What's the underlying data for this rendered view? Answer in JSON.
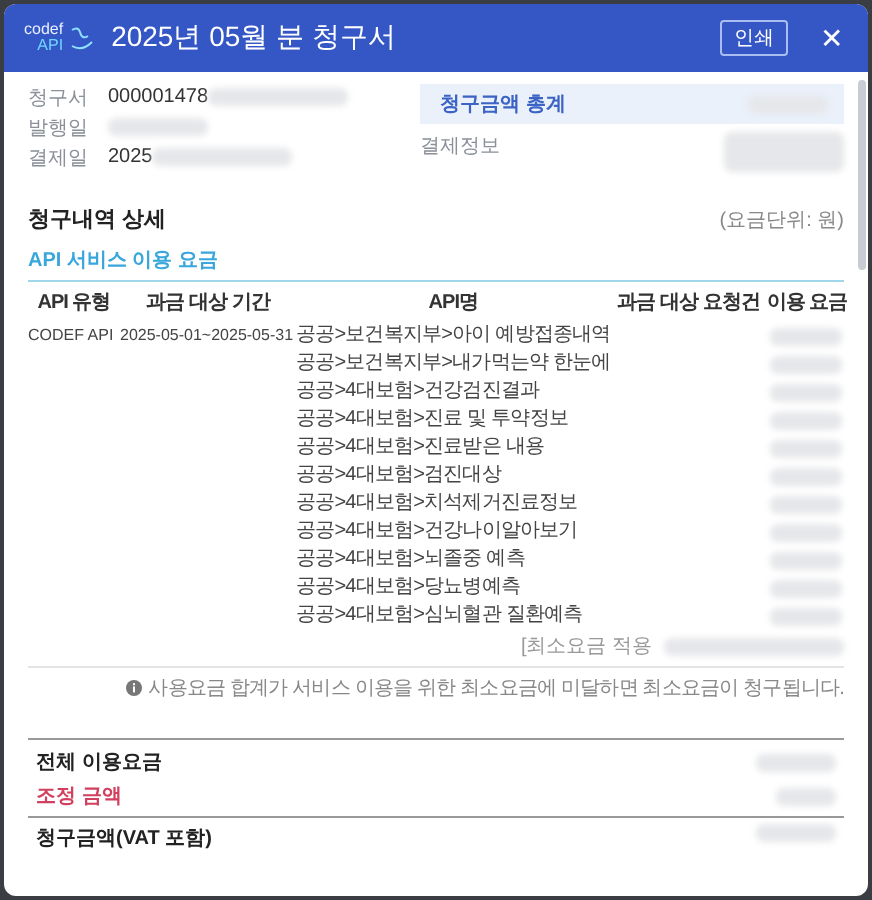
{
  "header": {
    "logo_top": "codef",
    "logo_bottom": "API",
    "title": "2025년 05월 분 청구서",
    "print_button": "인쇄",
    "close_button": "✕"
  },
  "invoice_info": [
    {
      "label": "청구서",
      "value": "000001478"
    },
    {
      "label": "발행일"
    },
    {
      "label": "결제일",
      "value": "2025"
    }
  ],
  "summary": {
    "total_label": "청구금액 총계",
    "payment_label": "결제정보"
  },
  "detail": {
    "title": "청구내역 상세",
    "unit": "(요금단위: 원)",
    "section": "API 서비스 이용 요금",
    "columns": [
      "API 유형",
      "과금 대상 기간",
      "API명",
      "과금 대상 요청건",
      "이용 요금"
    ],
    "api_type": "CODEF API",
    "period": "2025-05-01~2025-05-31",
    "api_names": [
      "공공>보건복지부>아이 예방접종내역",
      "공공>보건복지부>내가먹는약 한눈에",
      "공공>4대보험>건강검진결과",
      "공공>4대보험>진료 및 투약정보",
      "공공>4대보험>진료받은 내용",
      "공공>4대보험>검진대상",
      "공공>4대보험>치석제거진료정보",
      "공공>4대보험>건강나이알아보기",
      "공공>4대보험>뇌졸중 예측",
      "공공>4대보험>당뇨병예측",
      "공공>4대보험>심뇌혈관 질환예측"
    ],
    "minimum": "[최소요금 적용",
    "note": "사용요금 합계가 서비스 이용을 위한 최소요금에 미달하면 최소요금이 청구됩니다."
  },
  "totals": {
    "total_usage": "전체 이용요금",
    "adjustment": "조정 금액",
    "billed": "청구금액(VAT 포함)"
  }
}
